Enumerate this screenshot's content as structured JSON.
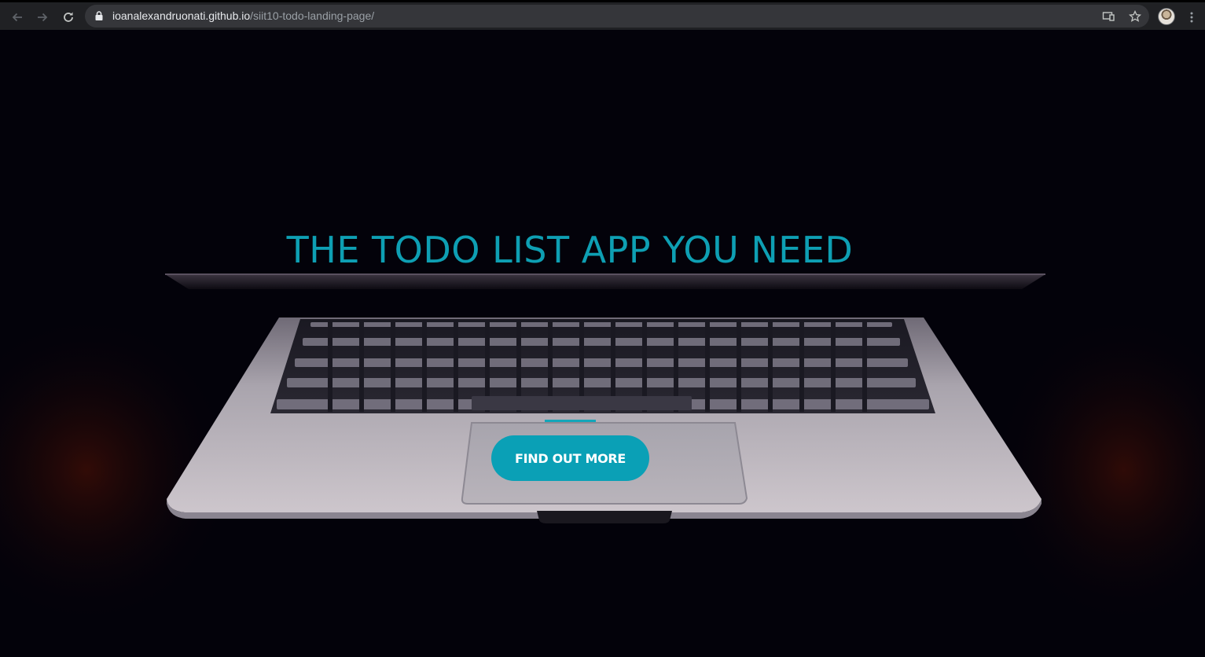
{
  "browser": {
    "url_host": "ioanalexandruonati.github.io",
    "url_path": "/siit10-todo-landing-page/",
    "icons": [
      "back-arrow-icon",
      "forward-arrow-icon",
      "reload-icon",
      "lock-icon",
      "cast-icon",
      "bookmark-star-icon",
      "avatar",
      "kebab-menu-icon"
    ]
  },
  "hero": {
    "title": "THE TODO LIST APP YOU NEED",
    "cta_label": "FIND OUT MORE",
    "accent_color": "#0e9fb3",
    "background_image": "laptop-keyboard-in-dark"
  }
}
